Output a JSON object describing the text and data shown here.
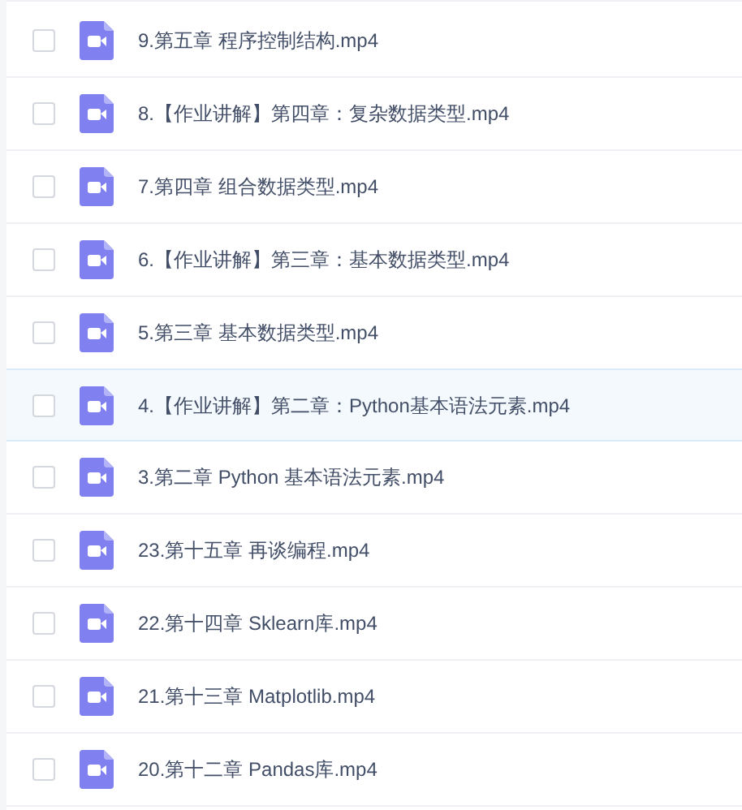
{
  "files": [
    {
      "name": "9.第五章 程序控制结构.mp4",
      "checked": false,
      "highlighted": false
    },
    {
      "name": "8.【作业讲解】第四章：复杂数据类型.mp4",
      "checked": false,
      "highlighted": false
    },
    {
      "name": "7.第四章 组合数据类型.mp4",
      "checked": false,
      "highlighted": false
    },
    {
      "name": "6.【作业讲解】第三章：基本数据类型.mp4",
      "checked": false,
      "highlighted": false
    },
    {
      "name": "5.第三章 基本数据类型.mp4",
      "checked": false,
      "highlighted": false
    },
    {
      "name": "4.【作业讲解】第二章：Python基本语法元素.mp4",
      "checked": false,
      "highlighted": true
    },
    {
      "name": "3.第二章 Python 基本语法元素.mp4",
      "checked": false,
      "highlighted": false
    },
    {
      "name": "23.第十五章 再谈编程.mp4",
      "checked": false,
      "highlighted": false
    },
    {
      "name": "22.第十四章 Sklearn库.mp4",
      "checked": false,
      "highlighted": false
    },
    {
      "name": "21.第十三章 Matplotlib.mp4",
      "checked": false,
      "highlighted": false
    },
    {
      "name": "20.第十二章 Pandas库.mp4",
      "checked": false,
      "highlighted": false
    }
  ]
}
